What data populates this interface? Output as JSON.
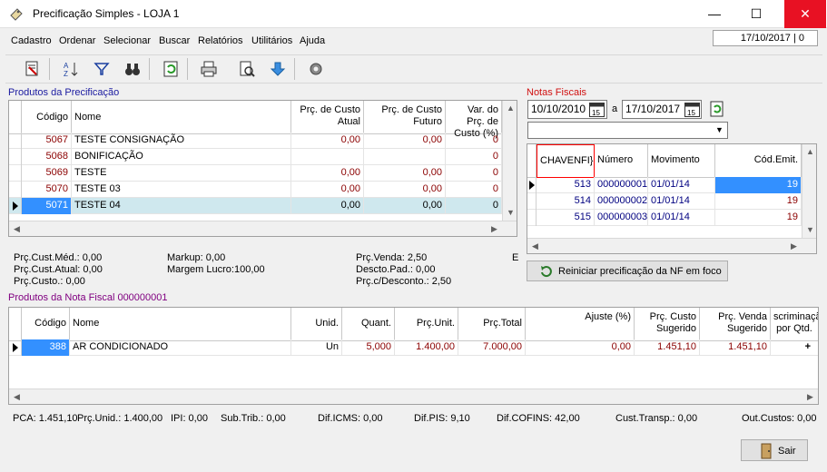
{
  "window": {
    "title": "Precificação Simples - LOJA 1",
    "min": "—",
    "max": "☐",
    "close": "✕"
  },
  "menu": {
    "items": [
      "Cadastro",
      "Ordenar",
      "Selecionar",
      "Buscar",
      "Relatórios",
      "Utilitários",
      "Ajuda"
    ],
    "date_status": "17/10/2017 | 0"
  },
  "toolbar": {
    "icons": [
      "clear-icon",
      "sort-az-icon",
      "filter-icon",
      "binoculars-icon",
      "refresh-icon",
      "print-icon",
      "preview-icon",
      "down-arrow-icon",
      "settings-icon"
    ]
  },
  "produtos": {
    "label": "Produtos da Precificação",
    "headers": {
      "codigo": "Código",
      "nome": "Nome",
      "custo_atual": "Prç. de Custo Atual",
      "custo_futuro": "Prç. de Custo Futuro",
      "var_preco": "Var. do Prç. de Custo (%)"
    },
    "rows": [
      {
        "codigo": "5067",
        "nome": "TESTE CONSIGNAÇÃO",
        "atual": "0,00",
        "futuro": "0,00",
        "var": "0"
      },
      {
        "codigo": "5068",
        "nome": "BONIFICAÇÃO",
        "atual": "",
        "futuro": "",
        "var": "0"
      },
      {
        "codigo": "5069",
        "nome": "TESTE",
        "atual": "0,00",
        "futuro": "0,00",
        "var": "0"
      },
      {
        "codigo": "5070",
        "nome": "TESTE 03",
        "atual": "0,00",
        "futuro": "0,00",
        "var": "0"
      },
      {
        "codigo": "5071",
        "nome": "TESTE 04",
        "atual": "0,00",
        "futuro": "0,00",
        "var": "0"
      }
    ]
  },
  "info": {
    "cust_med": "Prç.Cust.Méd.: 0,00",
    "cust_atual": "Prç.Cust.Atual: 0,00",
    "custo": "Prç.Custo.: 0,00",
    "markup": "Markup: 0,00",
    "margem": "Margem Lucro:100,00",
    "venda": "Prç.Venda: 2,50",
    "descto_pad": "Descto.Pad.: 0,00",
    "c_descto": "Prç.c/Desconto.: 2,50",
    "extra": "E"
  },
  "notas": {
    "label": "Notas Fiscais",
    "date_from": "10/10/2010",
    "date_sep": "a",
    "date_to": "17/10/2017",
    "headers": {
      "chave": "CHAVENFI}",
      "numero": "Número",
      "movimento": "Movimento",
      "cod_emit": "Cód.Emit."
    },
    "rows": [
      {
        "chave": "513",
        "numero": "000000001",
        "movimento": "01/01/14",
        "cod": "19"
      },
      {
        "chave": "514",
        "numero": "000000002",
        "movimento": "01/01/14",
        "cod": "19"
      },
      {
        "chave": "515",
        "numero": "000000003",
        "movimento": "01/01/14",
        "cod": "19"
      }
    ],
    "reiniciar": "Reiniciar precificação da NF em foco"
  },
  "itens": {
    "label": "Produtos da Nota Fiscal 000000001",
    "headers": {
      "codigo": "Código",
      "nome": "Nome",
      "unid": "Unid.",
      "quant": "Quant.",
      "unit": "Prç.Unit.",
      "total": "Prç.Total",
      "ajuste": "Ajuste (%)",
      "custo_sug": "Prç. Custo Sugerido",
      "venda_sug": "Prç. Venda Sugerido",
      "discr": "scriminaçã por Qtd."
    },
    "rows": [
      {
        "codigo": "388",
        "nome": "AR CONDICIONADO",
        "unid": "Un",
        "quant": "5,000",
        "unit": "1.400,00",
        "total": "7.000,00",
        "ajuste": "0,00",
        "custo_sug": "1.451,10",
        "venda_sug": "1.451,10",
        "discr": "+"
      }
    ]
  },
  "footer": {
    "pca": "PCA: 1.451,10",
    "unid": "Prç.Unid.: 1.400,00",
    "ipi": "IPI: 0,00",
    "sub_trib": "Sub.Trib.: 0,00",
    "icms": "Dif.ICMS: 0,00",
    "pis": "Dif.PIS: 9,10",
    "cofins": "Dif.COFINS: 42,00",
    "transp": "Cust.Transp.: 0,00",
    "out": "Out.Custos: 0,00",
    "sair": "Sair"
  }
}
